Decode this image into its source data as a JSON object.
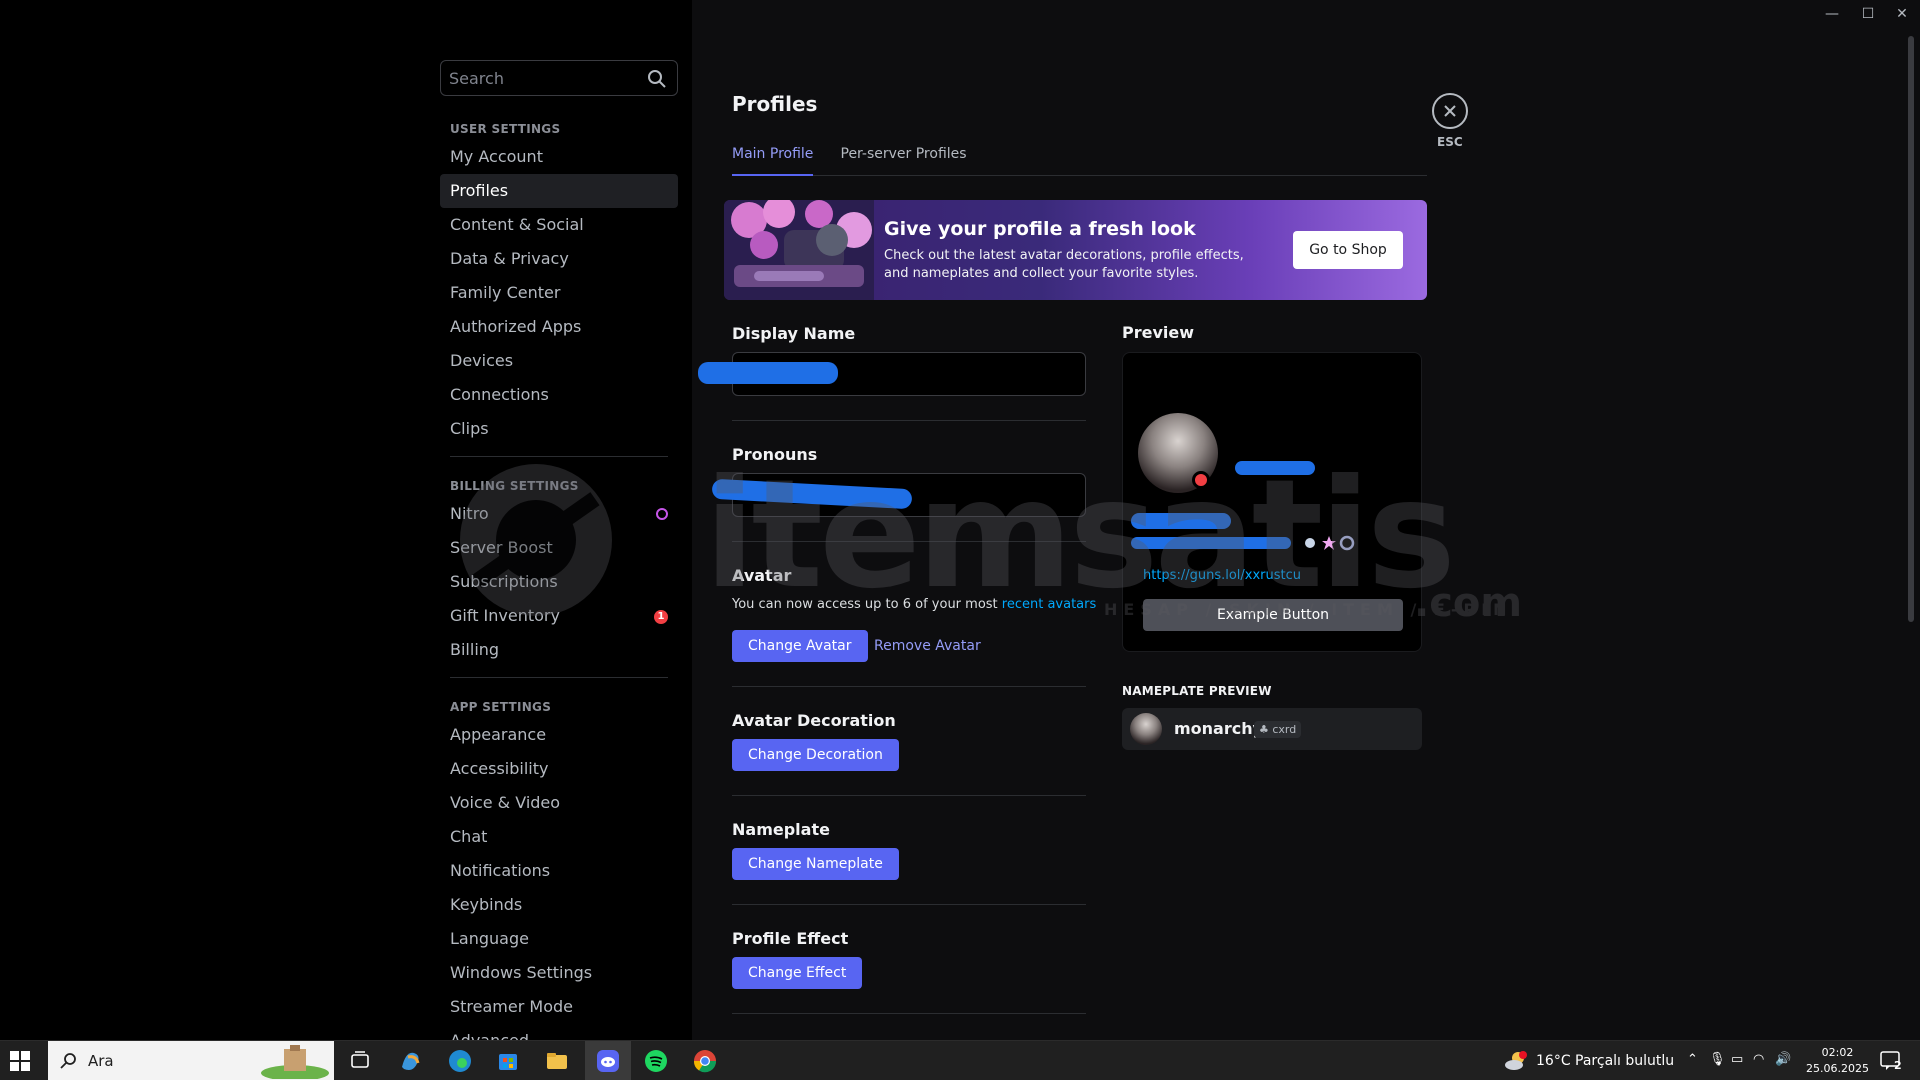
{
  "search": {
    "placeholder": "Search"
  },
  "nav": {
    "user_settings_header": "USER SETTINGS",
    "user_settings": [
      "My Account",
      "Profiles",
      "Content & Social",
      "Data & Privacy",
      "Family Center",
      "Authorized Apps",
      "Devices",
      "Connections",
      "Clips"
    ],
    "billing_header": "BILLING SETTINGS",
    "billing": [
      "Nitro",
      "Server Boost",
      "Subscriptions",
      "Gift Inventory",
      "Billing"
    ],
    "gift_badge": "1",
    "app_header": "APP SETTINGS",
    "app": [
      "Appearance",
      "Accessibility",
      "Voice & Video",
      "Chat",
      "Notifications",
      "Keybinds",
      "Language",
      "Windows Settings",
      "Streamer Mode",
      "Advanced"
    ]
  },
  "page": {
    "title": "Profiles",
    "tabs": [
      "Main Profile",
      "Per-server Profiles"
    ]
  },
  "banner": {
    "title": "Give your profile a fresh look",
    "text": "Check out the latest avatar decorations, profile effects, and nameplates and collect your favorite styles.",
    "button": "Go to Shop"
  },
  "form": {
    "display_name_label": "Display Name",
    "pronouns_label": "Pronouns",
    "avatar_label": "Avatar",
    "avatar_text": "You can now access up to 6 of your most ",
    "avatar_link": "recent avatars",
    "change_avatar": "Change Avatar",
    "remove_avatar": "Remove Avatar",
    "decoration_label": "Avatar Decoration",
    "change_decoration": "Change Decoration",
    "nameplate_label": "Nameplate",
    "change_nameplate": "Change Nameplate",
    "effect_label": "Profile Effect",
    "change_effect": "Change Effect"
  },
  "preview": {
    "label": "Preview",
    "link": "https://guns.lol/xxrustcu",
    "example_button": "Example Button",
    "nameplate_label": "NAMEPLATE PREVIEW",
    "nameplate_name": "monarchy",
    "nameplate_tag": "cxrd"
  },
  "close": {
    "label": "ESC"
  },
  "watermark": {
    "text": "itemsatis",
    "sub": "HESAP / SKIN / ITEM / E-PIN",
    "com": ".com"
  },
  "taskbar": {
    "search_text": "Ara",
    "weather": "16°C  Parçalı bulutlu",
    "time": "02:02",
    "date": "25.06.2025",
    "notifications": "2"
  },
  "colors": {
    "accent": "#5865f2",
    "link": "#00a8fc",
    "danger": "#f23f43"
  }
}
